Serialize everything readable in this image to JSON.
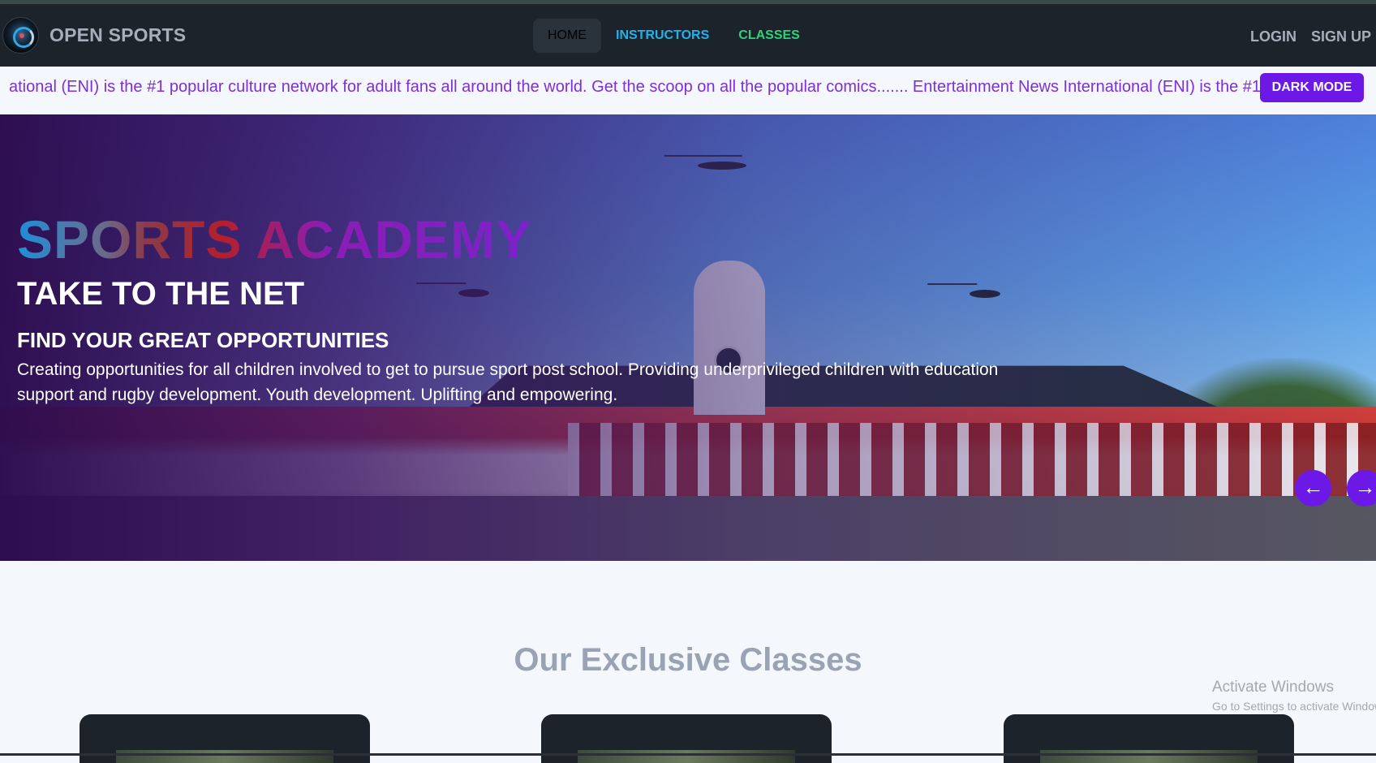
{
  "navbar": {
    "brand": "OPEN SPORTS",
    "logo_icon": "open-sports-logo",
    "links": {
      "home": "HOME",
      "instructors": "INSTRUCTORS",
      "classes": "CLASSES"
    },
    "login": "LOGIN",
    "signup": "SIGN UP",
    "colors": {
      "background": "#1d232a",
      "instructors": "#1fb2f0",
      "classes": "#2bd37a"
    }
  },
  "ticker": {
    "text": "ational (ENI) is the #1 popular culture network for adult fans all around the world. Get the scoop on all the popular comics....... Entertainment News International (ENI) is the #1",
    "color": "#7e2fd6"
  },
  "theme_toggle": {
    "label": "DARK MODE",
    "color": "#6c19e8"
  },
  "hero": {
    "title": "SPORTS ACADEMY",
    "subtitle": "TAKE TO THE NET",
    "tagline": "FIND YOUR GREAT OPPORTUNITIES",
    "description": "Creating opportunities for all children involved to get to pursue sport post school. Providing underprivileged children with education support and rugby development. Youth development. Uplifting and empowering.",
    "prev_icon": "arrow-left-icon",
    "next_icon": "arrow-right-icon"
  },
  "classes_section": {
    "title": "Our Exclusive Classes"
  },
  "windows_watermark": {
    "line1": "Activate Windows",
    "line2": "Go to Settings to activate Windows."
  }
}
